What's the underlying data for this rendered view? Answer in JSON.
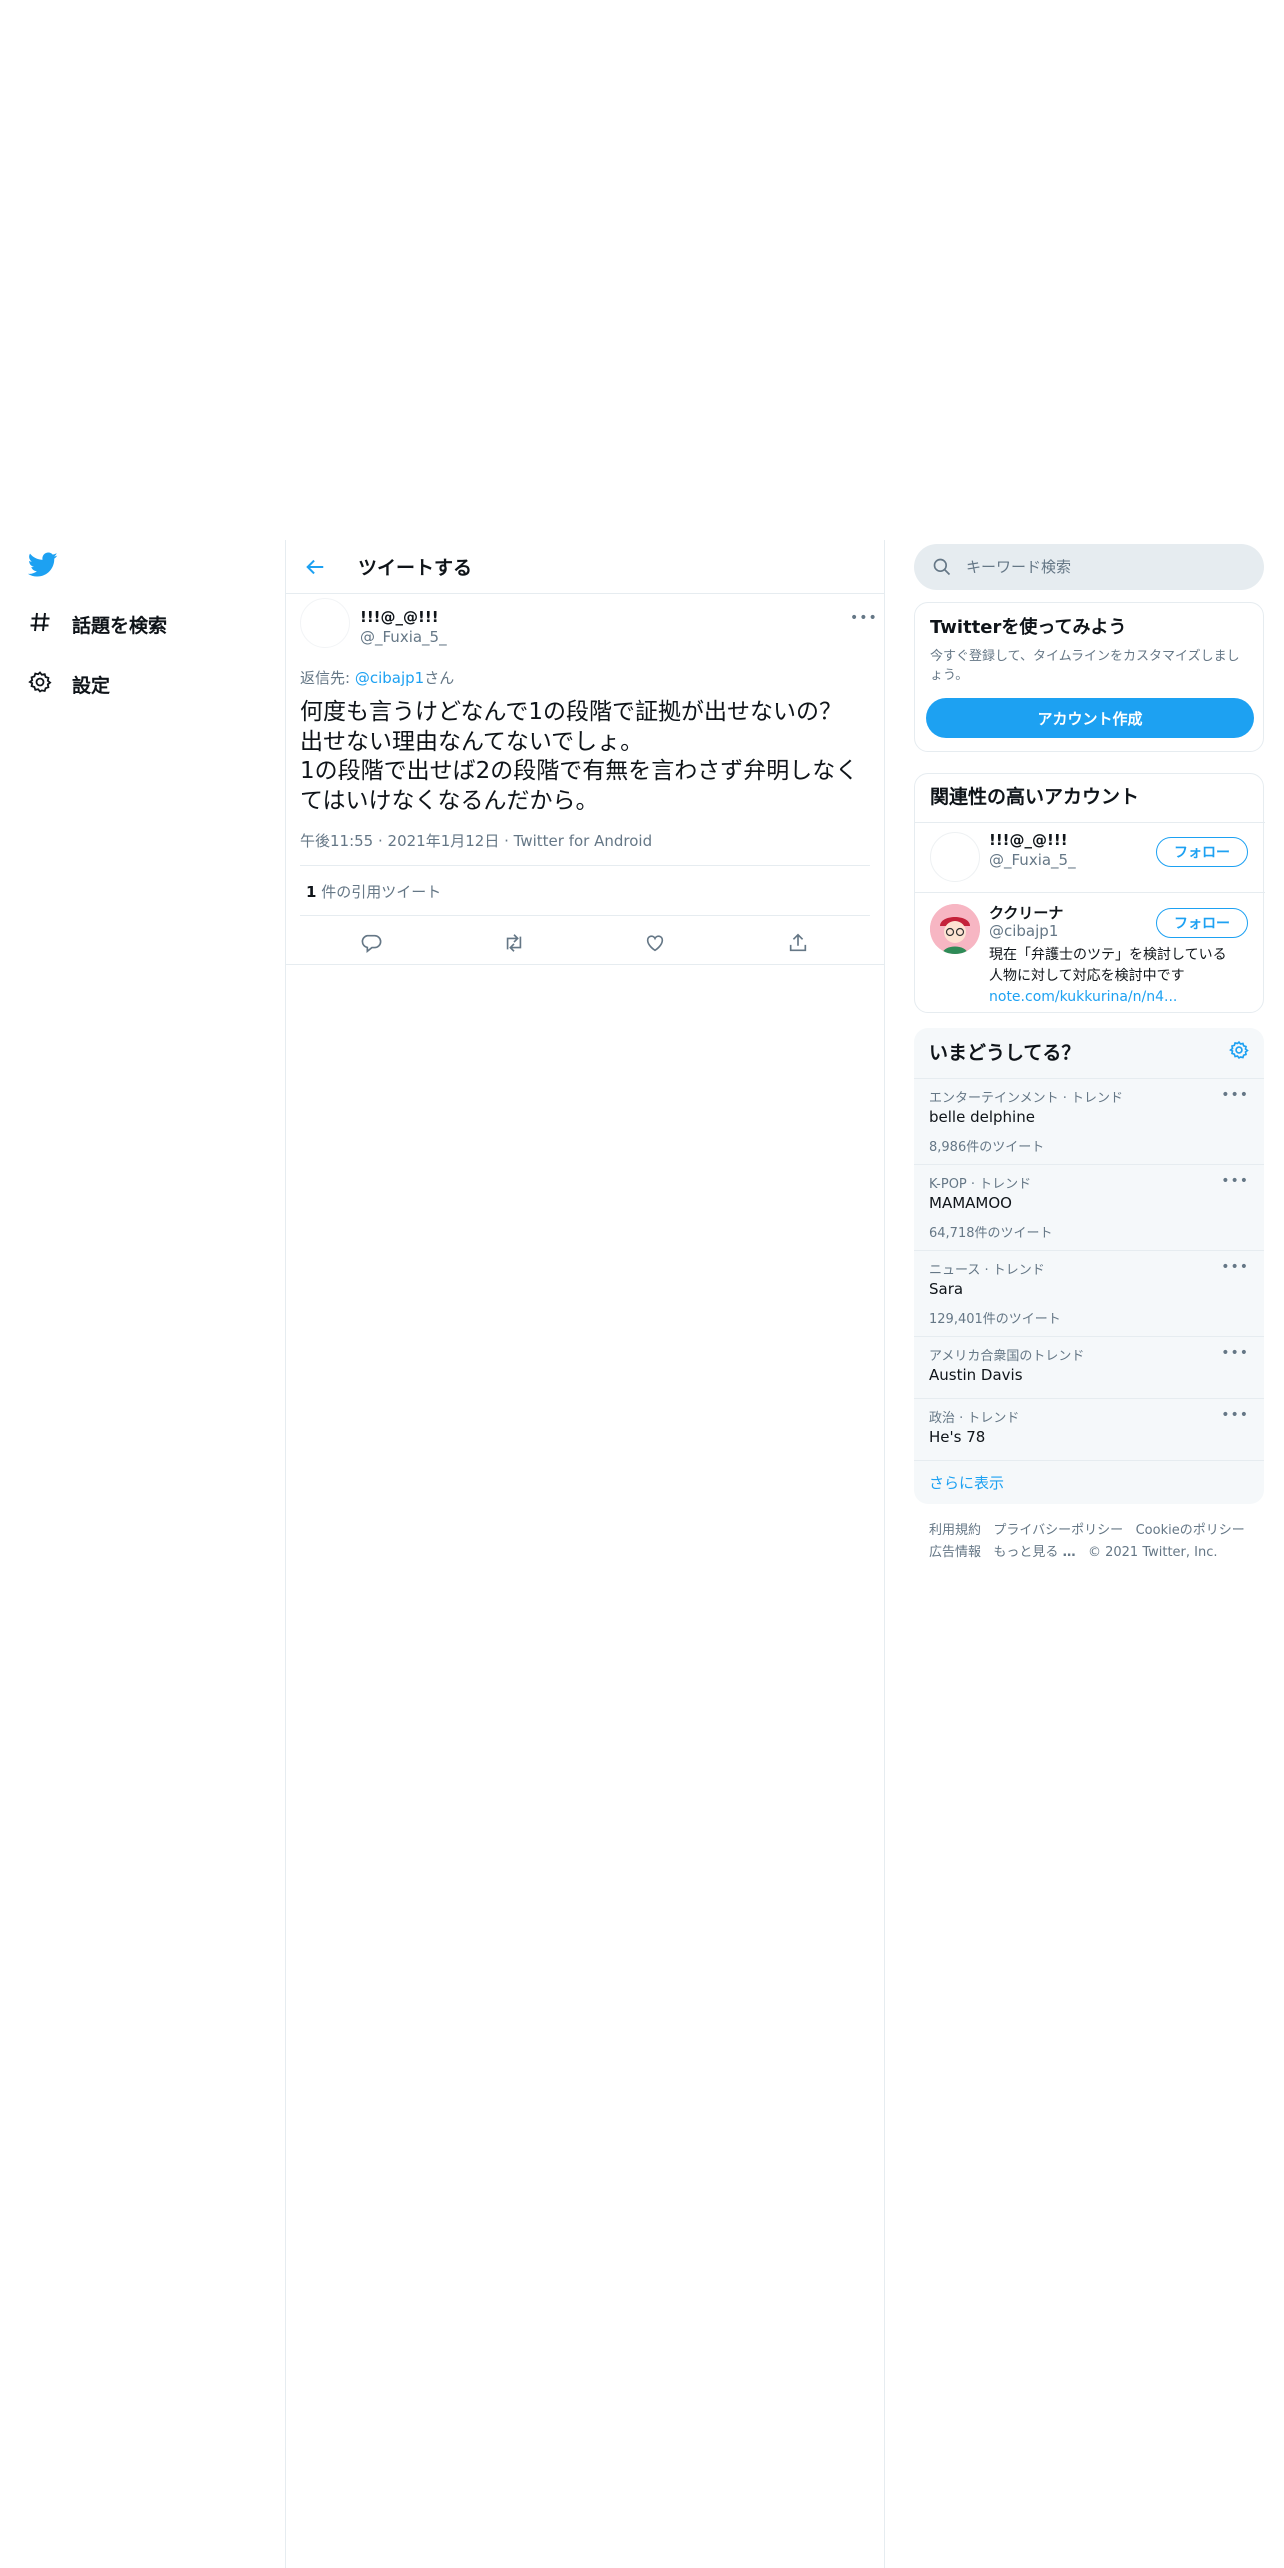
{
  "nav": {
    "items": [
      {
        "label": "話題を検索",
        "icon": "hashtag-icon"
      },
      {
        "label": "設定",
        "icon": "gear-icon"
      }
    ]
  },
  "header": {
    "title": "ツイートする"
  },
  "tweet": {
    "author_name": "!!!@_@!!!",
    "author_handle": "@_Fuxia_5_",
    "reply_prefix": "返信先: ",
    "reply_to": "@cibajp1",
    "reply_suffix": "さん",
    "text_lines": [
      "何度も言うけどなんで1の段階で証拠が出せないの？",
      "出せない理由なんてないでしょ。",
      "1の段階で出せば2の段階で有無を言わさず弁明しなく",
      "てはいけなくなるんだから。"
    ],
    "time": "午後11:55",
    "date": "2021年1月12日",
    "source": "Twitter for Android",
    "quote_count": "1",
    "quote_label": " 件の引用ツイート"
  },
  "search": {
    "placeholder": "キーワード検索"
  },
  "signup": {
    "title": "Twitterを使ってみよう",
    "desc": "今すぐ登録して、タイムラインをカスタマイズしましょう。",
    "button": "アカウント作成"
  },
  "related": {
    "title": "関連性の高いアカウント",
    "accounts": [
      {
        "name": "!!!@_@!!!",
        "handle": "@_Fuxia_5_",
        "follow": "フォロー"
      },
      {
        "name": "ククリーナ",
        "handle": "@cibajp1",
        "follow": "フォロー",
        "bio_1": "現在「弁護士のツテ」を検討している",
        "bio_2": "人物に対して対応を検討中です",
        "link": "note.com/kukkurina/n/n4..."
      }
    ]
  },
  "trends": {
    "title": "いまどうしてる？",
    "items": [
      {
        "context": "エンターテインメント · トレンド",
        "name": "belle delphine",
        "count": "8,986件のツイート"
      },
      {
        "context": "K-POP · トレンド",
        "name": "MAMAMOO",
        "count": "64,718件のツイート"
      },
      {
        "context": "ニュース · トレンド",
        "name": "Sara",
        "count": "129,401件のツイート"
      },
      {
        "context": "アメリカ合衆国のトレンド",
        "name": "Austin Davis",
        "count": ""
      },
      {
        "context": "政治 · トレンド",
        "name": "He's 78",
        "count": ""
      }
    ],
    "show_more": "さらに表示"
  },
  "footer": {
    "terms": "利用規約",
    "privacy": "プライバシーポリシー",
    "cookie": "Cookieのポリシー",
    "ads": "広告情報",
    "more": "もっと見る",
    "copyright": "© 2021 Twitter, Inc."
  },
  "colors": {
    "accent": "#1da1f2",
    "text": "#0f1419",
    "secondary": "#657786",
    "border": "#e6ecf0"
  }
}
